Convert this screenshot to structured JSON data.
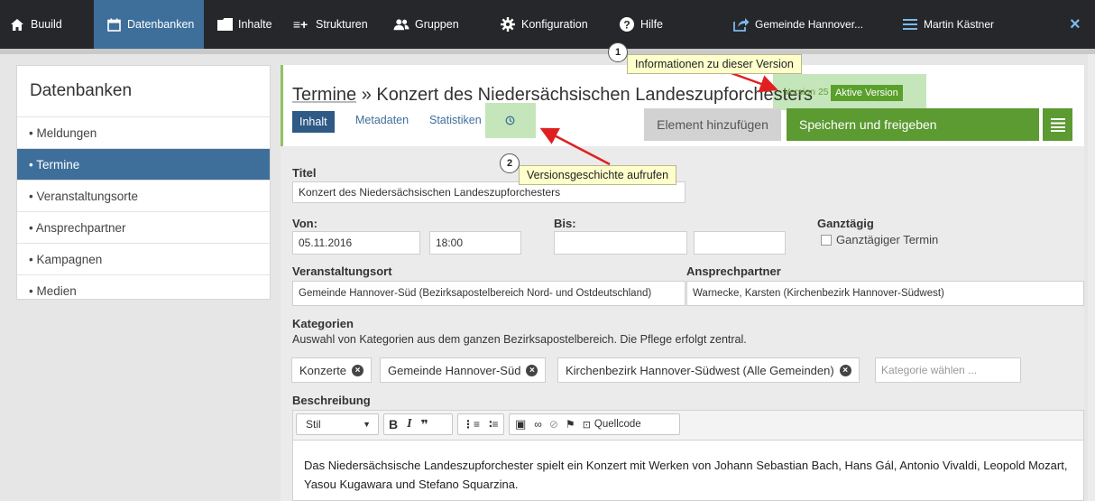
{
  "topnav": {
    "items": [
      {
        "label": "Buuild",
        "icon": "home-icon"
      },
      {
        "label": "Datenbanken",
        "icon": "calendar-icon"
      },
      {
        "label": "Inhalte",
        "icon": "folder-icon"
      },
      {
        "label": "Strukturen",
        "icon": "structure-icon"
      },
      {
        "label": "Gruppen",
        "icon": "users-icon"
      },
      {
        "label": "Konfiguration",
        "icon": "gear-icon"
      },
      {
        "label": "Hilfe",
        "icon": "help-icon"
      }
    ],
    "site": "Gemeinde Hannover...",
    "user": "Martin Kästner",
    "close": "×"
  },
  "sidebar": {
    "title": "Datenbanken",
    "items": [
      {
        "label": "• Meldungen"
      },
      {
        "label": "• Termine"
      },
      {
        "label": "• Veranstaltungsorte"
      },
      {
        "label": "• Ansprechpartner"
      },
      {
        "label": "• Kampagnen"
      },
      {
        "label": "• Medien"
      }
    ]
  },
  "header": {
    "crumb": "Termine",
    "separator": " » ",
    "title": "Konzert des Niedersächsischen Landeszupforchesters",
    "version": "Version 25",
    "version_status": "Aktive Version"
  },
  "tabs": [
    "Inhalt",
    "Metadaten",
    "Statistiken"
  ],
  "actions": {
    "add": "Element hinzufügen",
    "save": "Speichern und freigeben"
  },
  "form": {
    "title_label": "Titel",
    "title_value": "Konzert des Niedersächsischen Landeszupforchesters",
    "from_label": "Von:",
    "from_date": "05.11.2016",
    "from_time": "18:00",
    "to_label": "Bis:",
    "allday_label": "Ganztägig",
    "allday_checkbox": "Ganztägiger Termin",
    "venue_label": "Veranstaltungsort",
    "venue_value": "Gemeinde Hannover-Süd (Bezirksapostelbereich Nord- und Ostdeutschland)",
    "contact_label": "Ansprechpartner",
    "contact_value": "Warnecke, Karsten (Kirchenbezirk Hannover-Südwest)",
    "categories_label": "Kategorien",
    "categories_hint": "Auswahl von Kategorien aus dem ganzen Bezirksapostelbereich. Die Pflege erfolgt zentral.",
    "categories": [
      "Konzerte",
      "Gemeinde Hannover-Süd",
      "Kirchenbezirk Hannover-Südwest (Alle Gemeinden)"
    ],
    "category_placeholder": "Kategorie wählen ...",
    "description_label": "Beschreibung",
    "style_select": "Stil",
    "source_label": "Quellcode",
    "description_text": "Das Niedersächsische Landeszupforchester spielt ein Konzert mit Werken von Johann Sebastian Bach, Hans Gál, Antonio Vivaldi, Leopold Mozart, Yasou Kugawara und Stefano Squarzina."
  },
  "callouts": [
    {
      "number": "1",
      "text": "Informationen zu dieser Version"
    },
    {
      "number": "2",
      "text": "Versionsgeschichte aufrufen"
    }
  ],
  "colors": {
    "nav_bg": "#25272a",
    "active_blue": "#3e6f9b",
    "save_green": "#5c9a32",
    "arrow_red": "#e02020"
  }
}
